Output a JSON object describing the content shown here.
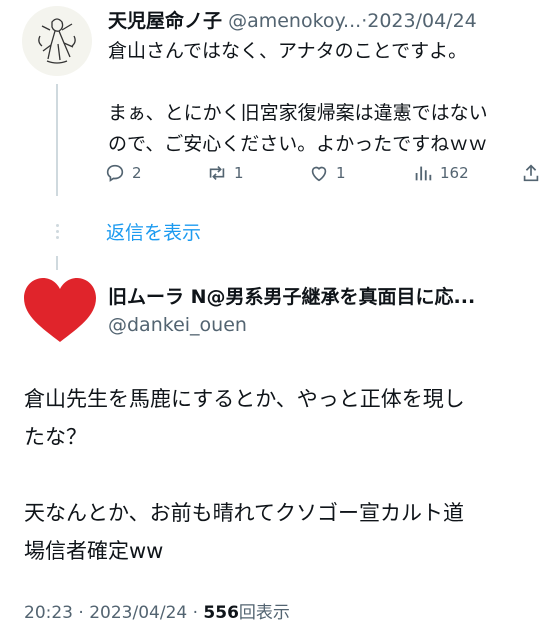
{
  "tweet1": {
    "name": "天児屋命ノ子",
    "handle": "@amenokoy...",
    "separator": "·",
    "date": "2023/04/24",
    "lines": [
      "倉山さんではなく、アナタのことですよ。",
      "まぁ、とにかく旧宮家復帰案は違憲ではない",
      "ので、ご安心ください。よかったですねｗｗ"
    ],
    "replies": "2",
    "retweets": "1",
    "likes": "1",
    "views": "162"
  },
  "show_replies_label": "返信を表示",
  "tweet2": {
    "name": "旧ムーラ N@男系男子継承を真面目に応...",
    "handle": "@dankei_ouen",
    "lines": [
      "倉山先生を馬鹿にするとか、やっと正体を現し",
      "たな？",
      "天なんとか、お前も晴れてクソゴー宣カルト道",
      "場信者確定ww"
    ],
    "time": "20:23",
    "separator": "·",
    "date": "2023/04/24",
    "separator2": "·",
    "views_count": "556",
    "views_label": "回表示"
  },
  "icons": {
    "reply": "reply-icon",
    "retweet": "retweet-icon",
    "like": "like-icon",
    "views": "views-icon",
    "share": "share-icon"
  },
  "colors": {
    "link": "#1d9bf0",
    "secondary_text": "#536471",
    "primary_text": "#0f1419",
    "heart_avatar": "#e0242b"
  }
}
